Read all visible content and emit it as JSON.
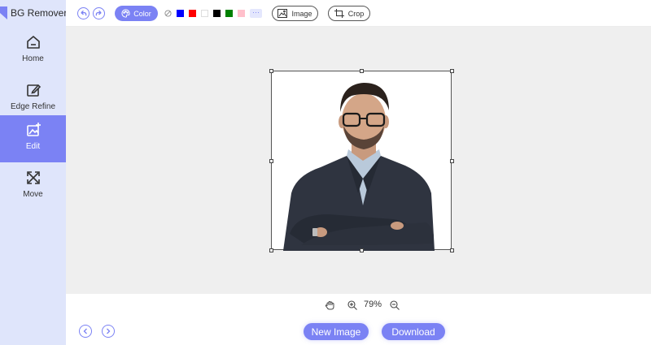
{
  "app": {
    "title": "BG Remover",
    "accent": "#7b82f4",
    "sidebar_bg": "#dfe5fb"
  },
  "sidebar": {
    "items": [
      {
        "label": "Home",
        "icon": "home-icon"
      },
      {
        "label": "Edge Refine",
        "icon": "edit-pencil-icon"
      },
      {
        "label": "Edit",
        "icon": "image-edit-icon",
        "active": true
      },
      {
        "label": "Move",
        "icon": "move-arrows-icon"
      }
    ]
  },
  "toolbar": {
    "color_label": "Color",
    "swatches": [
      "none",
      "#0000ff",
      "#ff0000",
      "#ffffff",
      "#000000",
      "#008000",
      "#ffc0cb"
    ],
    "more_label": "···",
    "image_label": "Image",
    "crop_label": "Crop"
  },
  "zoom": {
    "value": "79%"
  },
  "bottom": {
    "new_image_label": "New Image",
    "download_label": "Download"
  }
}
